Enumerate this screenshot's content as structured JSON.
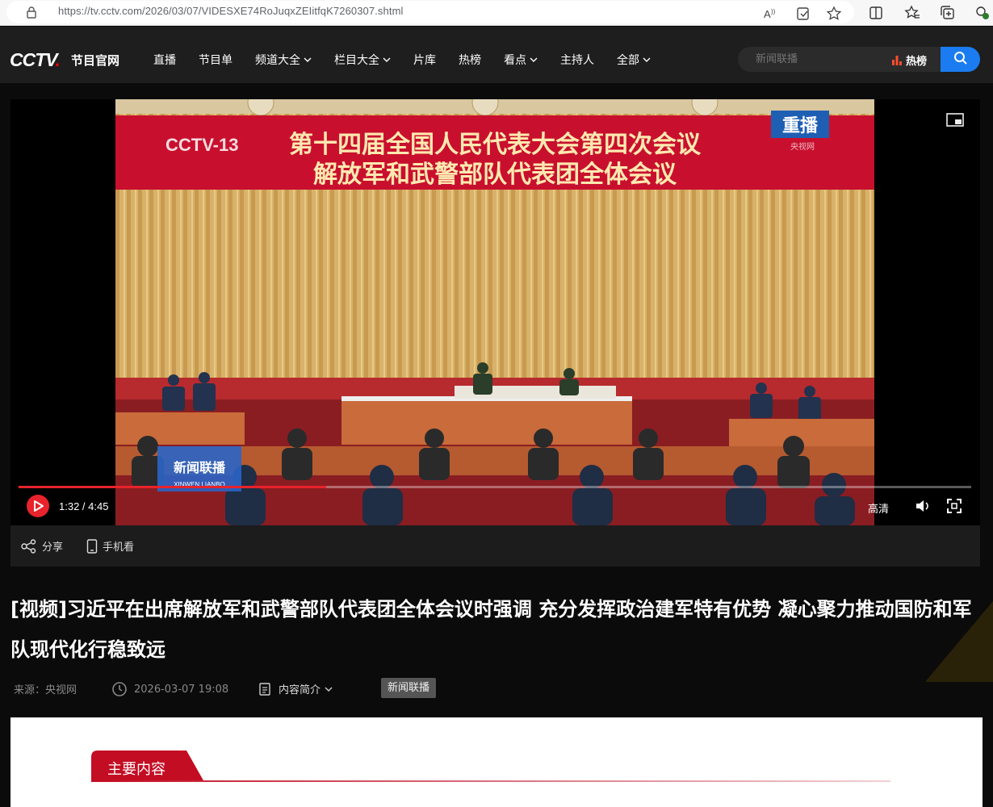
{
  "browser": {
    "url": "https://tv.cctv.com/2026/03/07/VIDESXE74RoJuqxZEIitfqK7260307.shtml",
    "icons": [
      "lock-icon",
      "read-aloud-icon",
      "immersive-reader-icon",
      "favorite-star-icon",
      "split-screen-icon",
      "favorites-icon",
      "collections-icon",
      "extensions-icon"
    ]
  },
  "header": {
    "logo_text": "CCTV",
    "logo_dot": ".",
    "logo_sub": "节目官网",
    "nav": [
      {
        "label": "直播",
        "dropdown": false
      },
      {
        "label": "节目单",
        "dropdown": false
      },
      {
        "label": "频道大全",
        "dropdown": true
      },
      {
        "label": "栏目大全",
        "dropdown": true
      },
      {
        "label": "片库",
        "dropdown": false
      },
      {
        "label": "热榜",
        "dropdown": false
      },
      {
        "label": "看点",
        "dropdown": true
      },
      {
        "label": "主持人",
        "dropdown": false
      },
      {
        "label": "全部",
        "dropdown": true
      }
    ],
    "search_placeholder": "新闻联播",
    "hot_label": "热榜",
    "accent": "#1a7cf0"
  },
  "player": {
    "video_banner_line1": "第十四届全国人民代表大会第四次会议",
    "video_banner_line2": "解放军和武警部队代表团全体会议",
    "channel_bug": "CCTV-13",
    "replay_badge": "重播",
    "watermark": "央视网",
    "program_logo": "新闻联播",
    "program_logo_pinyin": "XINWEN LIANBO",
    "current_time": "1:32",
    "duration": "4:45",
    "time_display": "1:32 / 4:45",
    "progress": 0.323,
    "buffered": 0.56,
    "quality": "高清",
    "progress_color": "#e8232b"
  },
  "actions": {
    "share": "分享",
    "mobile": "手机看"
  },
  "article": {
    "title": "[视频]习近平在出席解放军和武警部队代表团全体会议时强调 充分发挥政治建军特有优势 凝心聚力推动国防和军队现代化行稳致远",
    "source": "来源：央视网",
    "date": "2026-03-07 19:08",
    "summary_label": "内容简介",
    "tag": "新闻联播"
  },
  "section": {
    "title": "主要内容",
    "color": "#c30d23"
  }
}
